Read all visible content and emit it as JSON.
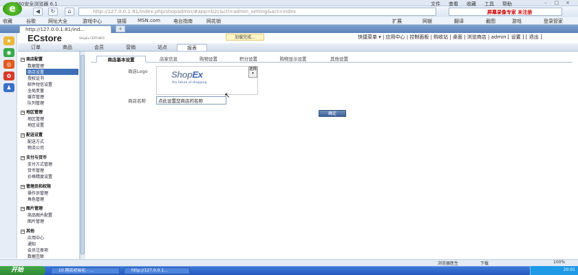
{
  "browser": {
    "title": "360安全浏览器 6.1",
    "menus": [
      "文件",
      "查看",
      "收藏",
      "工具",
      "帮助"
    ],
    "url": "http://127.0.0.1:81/index.php/shopadmin/#app=b2c&ctl=admin_setting&act=index",
    "search_promo": "屏幕录像专家 未注册",
    "favorites": [
      "收藏",
      "谷歌",
      "网址大全",
      "游戏中心",
      "链接",
      "MSN.com",
      "电台指南",
      "网花销"
    ],
    "right_tools": [
      "扩展",
      "网银",
      "翻译",
      "截图",
      "游戏",
      "登录管家"
    ],
    "tab_label": "http://127.0.0.1:81/ind...",
    "new_tab": "+"
  },
  "header": {
    "logo": "ECstore",
    "sub": "ShopEx CERT.INFO",
    "loading_tip": "加载完成...",
    "top_links": "快捷菜单 ▾ | 应用中心 | 控制面板 | 购收站 | 桌面 | 浏览商店 |  admin [ 设置 ] [ 退出 ]"
  },
  "main_nav": [
    "订单",
    "商品",
    "会员",
    "营销",
    "站点",
    "报表"
  ],
  "sidebar": {
    "groups": [
      {
        "title": "商店配置",
        "items": [
          "数据管理",
          "商店设置",
          "授权证书",
          "邮件短信设置",
          "全局变量",
          "缓存管理",
          "队列管理"
        ]
      },
      {
        "title": "地区管理",
        "items": [
          "地区管理",
          "地区设置"
        ]
      },
      {
        "title": "配送设置",
        "items": [
          "配送方式",
          "物流公司"
        ]
      },
      {
        "title": "支付与货币",
        "items": [
          "支付方式管理",
          "货币管理",
          "价格精度设置"
        ]
      },
      {
        "title": "管理员和权限",
        "items": [
          "操作员管理",
          "角色管理"
        ]
      },
      {
        "title": "图片管理",
        "items": [
          "商品图片配置",
          "图片管理"
        ]
      },
      {
        "title": "其他",
        "items": [
          "应用中心",
          "通知",
          "会员注册项",
          "数据互联"
        ]
      }
    ],
    "active": "商店设置"
  },
  "content": {
    "tabs": [
      "商店基本设置",
      "店家信息",
      "购物设置",
      "积分设置",
      "购物显示设置",
      "其他设置"
    ],
    "logo_label": "商店Logo",
    "logo_text_a": "Shop",
    "logo_text_b": "Ex",
    "logo_tagline": "the future of shopping",
    "choose_label": "选择",
    "name_label": "商店名称",
    "name_value": "点此设置您商店的名称",
    "ok_label": "确定"
  },
  "statusbar": {
    "doctor": "浏览器医生",
    "download": "下载",
    "zoom": "100%"
  },
  "taskbar": {
    "start": "开始",
    "tasks": [
      "10.网店初始化 - ...",
      "http://127.0.0.1..."
    ],
    "clock": "20:01"
  },
  "colors": {
    "accent": "#3d6fb6",
    "tabbar": "#5b83b8",
    "taskbar": "#2458c0",
    "promo": "#cc0000"
  }
}
